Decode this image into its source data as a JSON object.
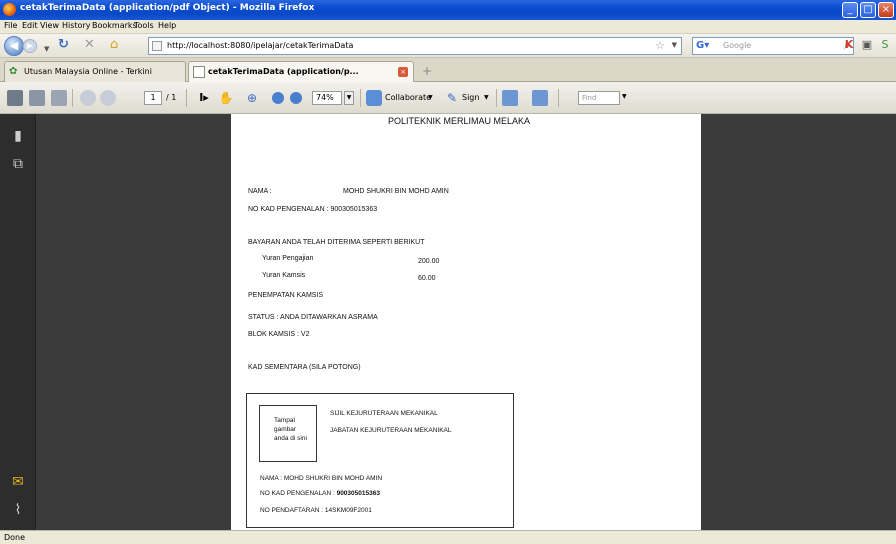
{
  "window": {
    "title": "cetakTerimaData (application/pdf Object) - Mozilla Firefox"
  },
  "menu": {
    "items": [
      "File",
      "Edit",
      "View",
      "History",
      "Bookmarks",
      "Tools",
      "Help"
    ]
  },
  "navigation": {
    "url": "http://localhost:8080/ipelajar/cetakTerimaData",
    "search_placeholder": "Google"
  },
  "tabs": [
    {
      "label": "Utusan Malaysia Online - Terkini",
      "active": false
    },
    {
      "label": "cetakTerimaData (application/p...",
      "active": true
    }
  ],
  "pdf_toolbar": {
    "page_current": "1",
    "page_total": "/ 1",
    "zoom": "74%",
    "collaborate_label": "Collaborate",
    "sign_label": "Sign",
    "find_placeholder": "Find"
  },
  "document": {
    "header": "POLITEKNIK MERLIMAU MELAKA",
    "nama_label": "NAMA :",
    "nama_value": "MOHD SHUKRI BIN MOHD AMIN",
    "ic_line": "NO KAD PENGENALAN : 900305015363",
    "payment_heading": "BAYARAN ANDA TELAH DITERIMA SEPERTI BERIKUT",
    "fees": [
      {
        "label": "Yuran Pengajian",
        "amount": "200.00"
      },
      {
        "label": "Yuran Kamsis",
        "amount": "60.00"
      }
    ],
    "placement_heading": "PENEMPATAN KAMSIS",
    "status_line": "STATUS :   ANDA DITAWARKAN ASRAMA",
    "blok_line": "BLOK KAMSIS :  V2",
    "temp_card_heading": "KAD SEMENTARA (SILA POTONG)",
    "card": {
      "photo_lines": [
        "Tampal",
        "gambar",
        "anda di sini"
      ],
      "cert_line": "SIJIL KEJURUTERAAN MEKANIKAL",
      "dept_line": "JABATAN KEJURUTERAAN MEKANIKAL",
      "name_line": "NAMA :  MOHD SHUKRI BIN MOHD AMIN",
      "ic_label": "NO KAD PENGENALAN : ",
      "ic_value": "900305015363",
      "reg_line": "NO PENDAFTARAN : 14SKM09F2001"
    }
  },
  "status": {
    "text": "Done"
  }
}
